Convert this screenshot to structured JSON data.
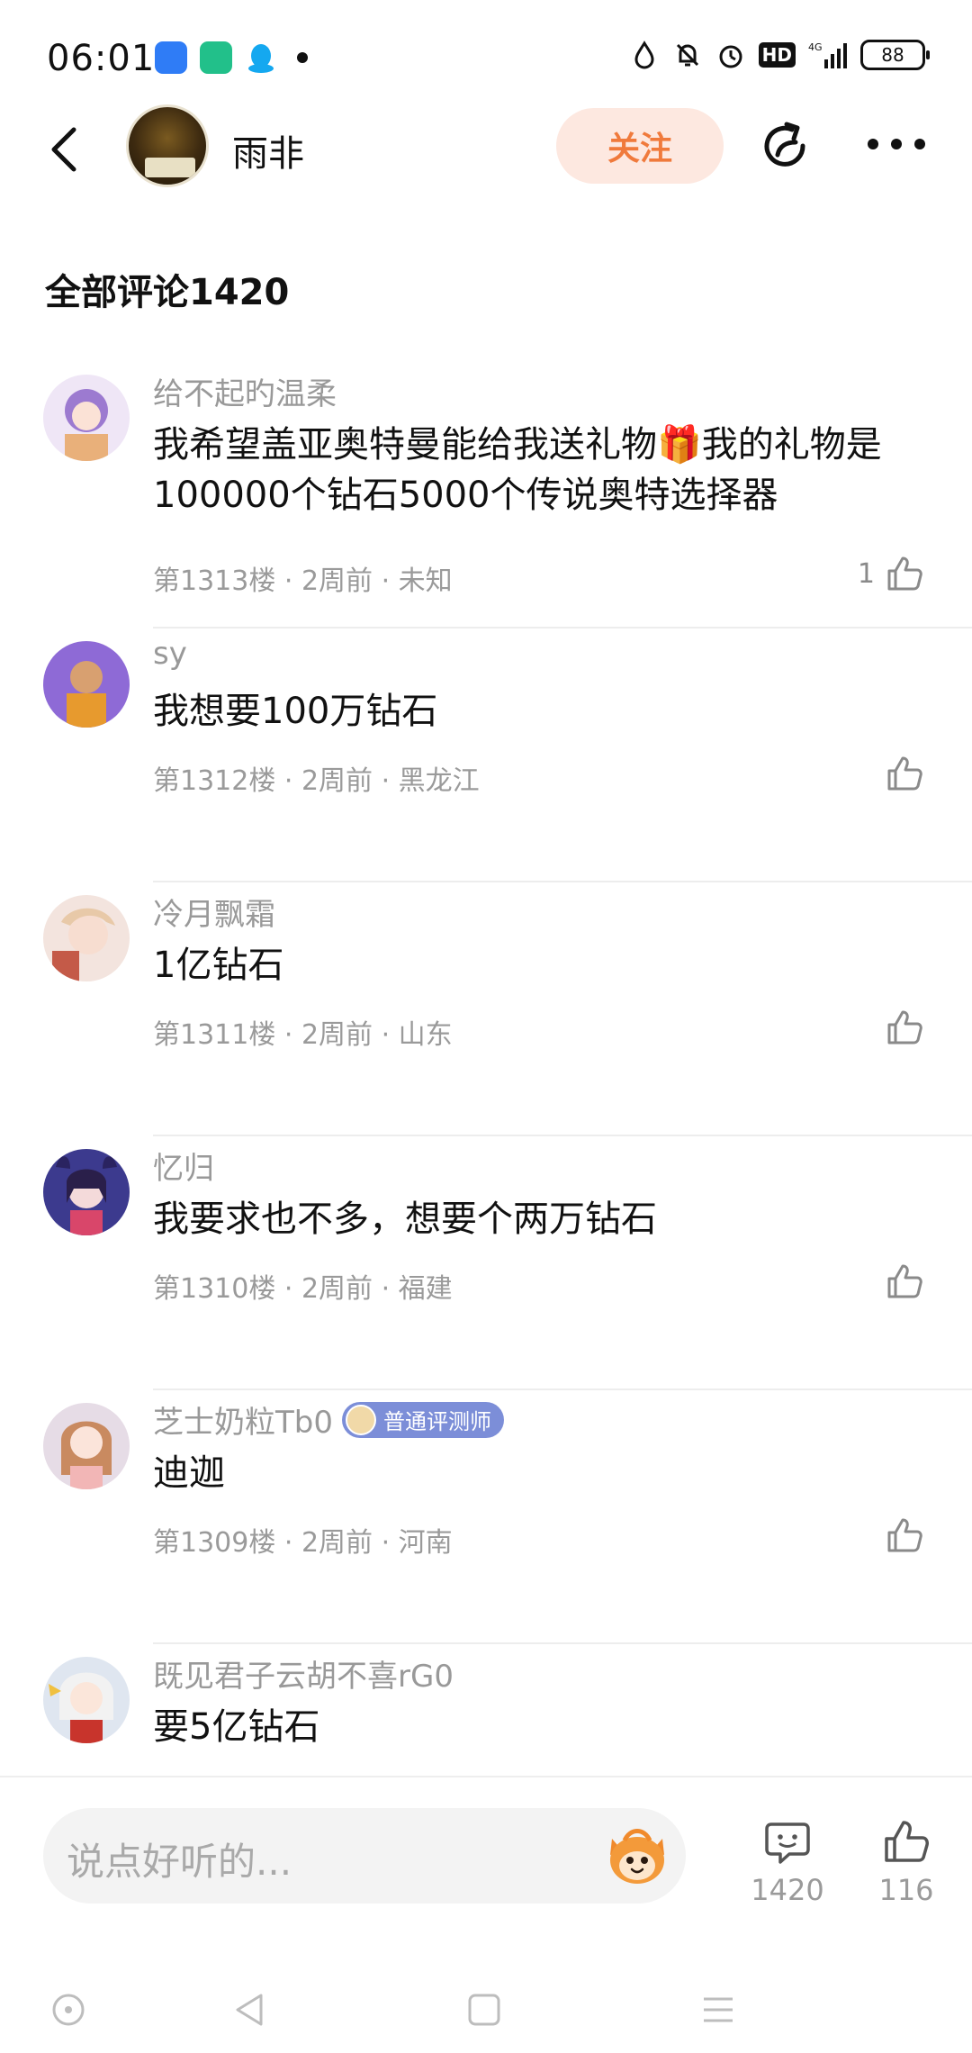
{
  "status_bar": {
    "time": "06:01",
    "network": "4G",
    "hd": "HD",
    "battery": "88"
  },
  "header": {
    "poster_name": "雨非",
    "follow_label": "关注"
  },
  "section": {
    "title": "全部评论1420"
  },
  "comments": [
    {
      "name": "给不起旳温柔",
      "text": "我希望盖亚奥特曼能给我送礼物🎁我的礼物是100000个钻石5000个传说奥特选择器",
      "meta": "第1313楼 · 2周前 · 未知",
      "likes": "1",
      "avatar_color": "#c9b3e8"
    },
    {
      "name": "sy",
      "text": "我想要100万钻石",
      "meta": "第1312楼 · 2周前 · 黑龙江",
      "likes": "",
      "avatar_color": "#8e6ad6"
    },
    {
      "name": "冷月飘霜",
      "text": "1亿钻石",
      "meta": "第1311楼 · 2周前 · 山东",
      "likes": "",
      "avatar_color": "#f1d6cc"
    },
    {
      "name": "忆归",
      "text": "我要求也不多，想要个两万钻石",
      "meta": "第1310楼 · 2周前 · 福建",
      "likes": "",
      "avatar_color": "#4a3a8a"
    },
    {
      "name": "芝士奶粒Tb0",
      "badge": "普通评测师",
      "text": "迪迦",
      "meta": "第1309楼 · 2周前 · 河南",
      "likes": "",
      "avatar_color": "#d9c8d8"
    },
    {
      "name": "既见君子云胡不喜rG0",
      "text": "要5亿钻石",
      "meta": "",
      "likes": "",
      "avatar_color": "#dfe6f0"
    }
  ],
  "bottom_bar": {
    "placeholder": "说点好听的...",
    "comment_count": "1420",
    "like_count": "116"
  },
  "colors": {
    "accent": "#f07a3c",
    "follow_bg": "#fde8e0",
    "badge_bg": "#7c8ed8",
    "meta_text": "#9a9a9a"
  },
  "icons": {
    "back": "chevron-left-icon",
    "share": "share-icon",
    "more": "more-dots-icon",
    "like": "thumbs-up-icon",
    "comment": "comment-icon",
    "emoji": "emoji-mascot-icon"
  }
}
